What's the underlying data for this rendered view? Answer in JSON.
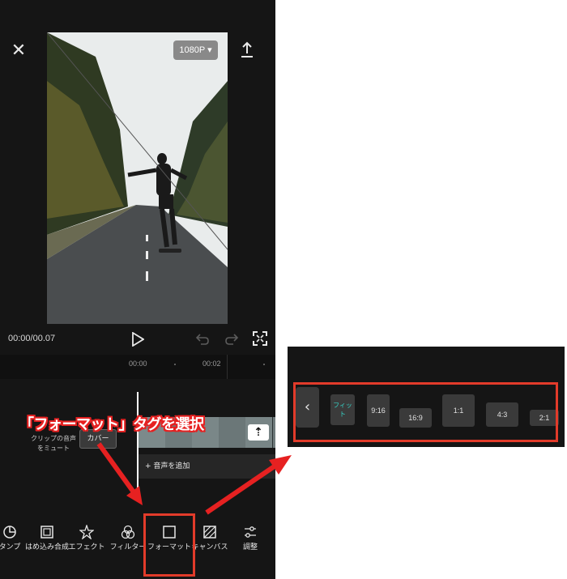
{
  "colors": {
    "accent_red": "#e23b2a",
    "teal": "#36d1c4",
    "dark_bg": "#151515"
  },
  "editor": {
    "resolution": "1080P",
    "time": "00:00/00.07",
    "ruler": {
      "tick_0": "00:00",
      "tick_1": "00:02"
    },
    "mute_label": "クリップの音声をミュート",
    "cover_label": "カバー",
    "add_audio": "+ 音声を追加",
    "toolbar": [
      {
        "label": "タンプ",
        "icon": "sticker-icon"
      },
      {
        "label": "はめ込み合成",
        "icon": "overlay-icon"
      },
      {
        "label": "エフェクト",
        "icon": "effect-icon"
      },
      {
        "label": "フィルター",
        "icon": "filter-icon"
      },
      {
        "label": "フォーマット",
        "icon": "format-icon"
      },
      {
        "label": "キャンバス",
        "icon": "canvas-icon"
      },
      {
        "label": "調整",
        "icon": "adjust-icon"
      }
    ]
  },
  "callout": "「フォーマット」タグを選択",
  "format_panel": {
    "back_icon": "chevron-left-icon",
    "options": [
      "フィット",
      "9:16",
      "16:9",
      "1:1",
      "4:3",
      "2:1"
    ]
  }
}
